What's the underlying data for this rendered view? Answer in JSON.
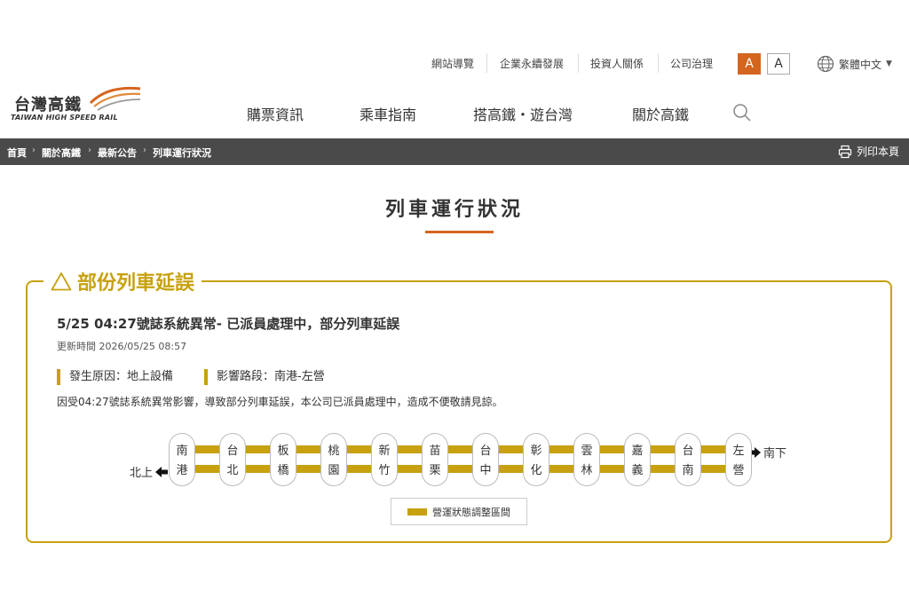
{
  "top_links": [
    "網站導覽",
    "企業永續發展",
    "投資人關係",
    "公司治理"
  ],
  "font_size_buttons": [
    "A",
    "A"
  ],
  "language": "繁體中文",
  "logo": {
    "zh": "台灣高鐵",
    "en": "TAIWAN HIGH SPEED RAIL"
  },
  "main_nav": [
    "購票資訊",
    "乘車指南",
    "搭高鐵・遊台灣",
    "關於高鐵"
  ],
  "breadcrumb": [
    "首頁",
    "關於高鐵",
    "最新公告",
    "列車運行狀況"
  ],
  "print_label": "列印本頁",
  "page_title": "列車運行狀況",
  "alert": {
    "heading": "部份列車延誤",
    "title": "5/25 04:27號誌系統異常- 已派員處理中，部分列車延誤",
    "updated": "更新時間 2026/05/25 08:57",
    "cause": "發生原因：地上設備",
    "section": "影響路段：南港-左營",
    "description": "因受04:27號誌系統異常影響，導致部分列車延誤，本公司已派員處理中，造成不便敬請見諒。"
  },
  "route": {
    "stations": [
      [
        "南",
        "港"
      ],
      [
        "台",
        "北"
      ],
      [
        "板",
        "橋"
      ],
      [
        "桃",
        "園"
      ],
      [
        "新",
        "竹"
      ],
      [
        "苗",
        "栗"
      ],
      [
        "台",
        "中"
      ],
      [
        "彰",
        "化"
      ],
      [
        "雲",
        "林"
      ],
      [
        "嘉",
        "義"
      ],
      [
        "台",
        "南"
      ],
      [
        "左",
        "營"
      ]
    ],
    "northbound": "北上",
    "southbound": "南下",
    "legend": "營運狀態調整區間"
  },
  "colors": {
    "accent": "#d4651f",
    "gold": "#c7a10f",
    "bar": "#4a4a4a"
  }
}
